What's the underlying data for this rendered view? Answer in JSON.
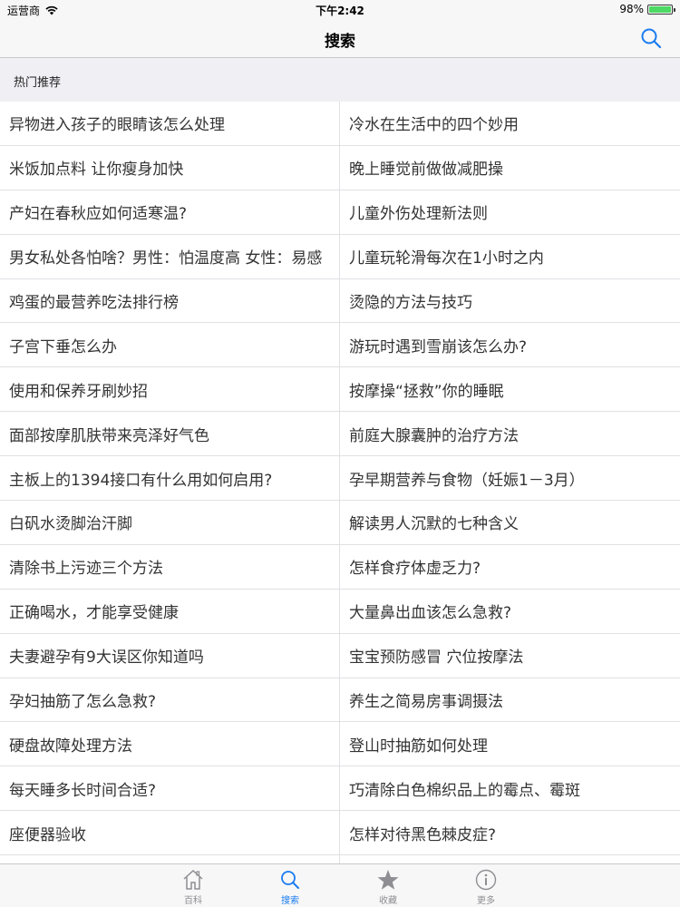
{
  "status_bar": {
    "carrier": "运营商",
    "time": "下午2:42",
    "battery_percent": "98%",
    "battery_level": 0.98,
    "battery_color": "#4cd964"
  },
  "nav": {
    "title": "搜索",
    "search_icon": "search-icon",
    "accent_color": "#1a7cf0"
  },
  "section": {
    "title": "热门推荐"
  },
  "rows": [
    [
      "异物进入孩子的眼睛该怎么处理",
      "冷水在生活中的四个妙用"
    ],
    [
      "米饭加点料 让你瘦身加快",
      "晚上睡觉前做做减肥操"
    ],
    [
      "产妇在春秋应如何适寒温?",
      "儿童外伤处理新法则"
    ],
    [
      "男女私处各怕啥？男性：怕温度高 女性：易感",
      "儿童玩轮滑每次在1小时之内"
    ],
    [
      "鸡蛋的最营养吃法排行榜",
      "烫隐的方法与技巧"
    ],
    [
      "子宫下垂怎么办",
      "游玩时遇到雪崩该怎么办?"
    ],
    [
      "使用和保养牙刷妙招",
      "按摩操“拯救”你的睡眠"
    ],
    [
      "面部按摩肌肤带来亮泽好气色",
      "前庭大腺囊肿的治疗方法"
    ],
    [
      "主板上的1394接口有什么用如何启用?",
      "孕早期营养与食物（妊娠1－3月）"
    ],
    [
      "白矾水烫脚治汗脚",
      "解读男人沉默的七种含义"
    ],
    [
      "清除书上污迹三个方法",
      "怎样食疗体虚乏力?"
    ],
    [
      "正确喝水，才能享受健康",
      "大量鼻出血该怎么急救?"
    ],
    [
      "夫妻避孕有9大误区你知道吗",
      "宝宝预防感冒 穴位按摩法"
    ],
    [
      "孕妇抽筋了怎么急救?",
      "养生之简易房事调摄法"
    ],
    [
      "硬盘故障处理方法",
      "登山时抽筋如何处理"
    ],
    [
      "每天睡多长时间合适?",
      "巧清除白色棉织品上的霉点、霉斑"
    ],
    [
      "座便器验收",
      "怎样对待黑色棘皮症?"
    ],
    [
      "",
      ""
    ]
  ],
  "tabs": [
    {
      "label": "百科",
      "icon": "house-icon",
      "active": false
    },
    {
      "label": "搜索",
      "icon": "search-icon",
      "active": true
    },
    {
      "label": "收藏",
      "icon": "star-icon",
      "active": false
    },
    {
      "label": "更多",
      "icon": "info-icon",
      "active": false
    }
  ]
}
